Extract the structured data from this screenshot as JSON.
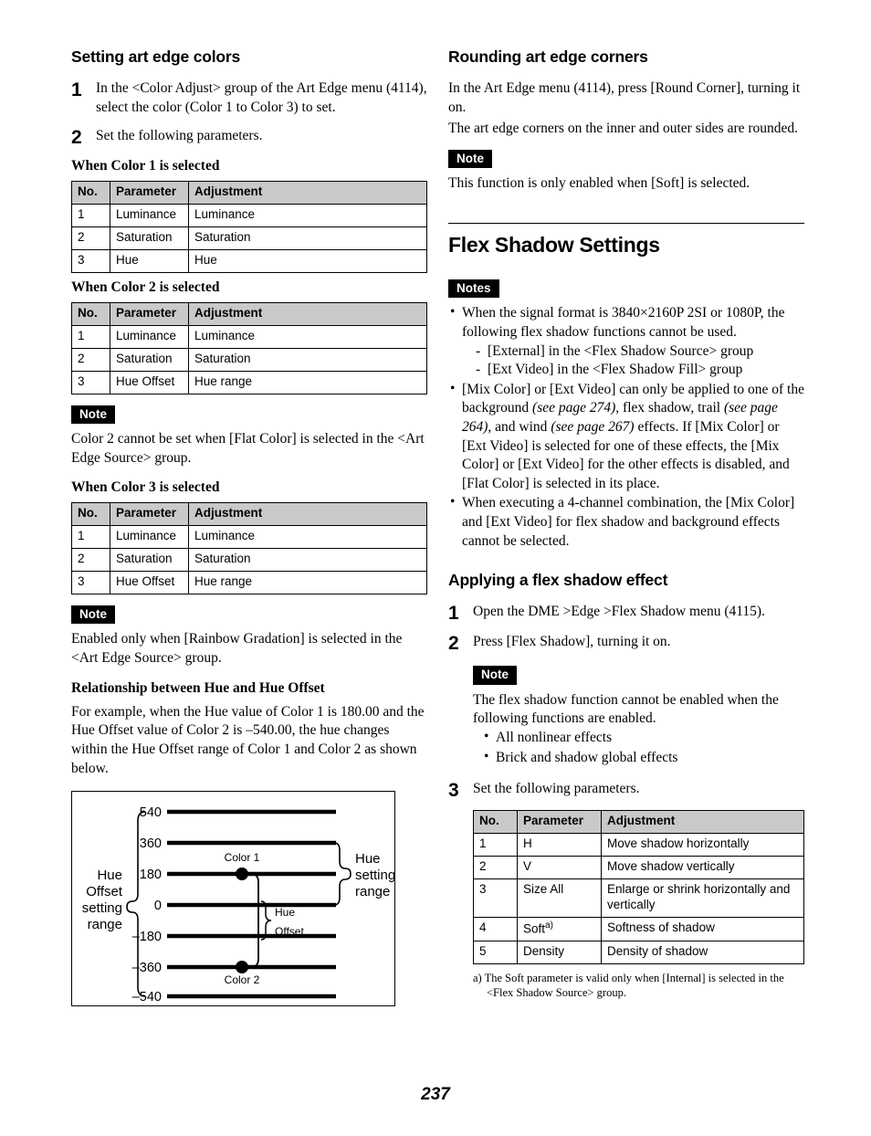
{
  "page": {
    "number": "237"
  },
  "left": {
    "heading": "Setting art edge colors",
    "step1_num": "1",
    "step1_text": "In the <Color Adjust> group of the Art Edge menu (4114), select the color (Color 1 to Color 3) to set.",
    "step2_num": "2",
    "step2_text": "Set the following parameters.",
    "color1_title": "When Color 1 is selected",
    "table1": {
      "headers": [
        "No.",
        "Parameter",
        "Adjustment"
      ],
      "rows": [
        [
          "1",
          "Luminance",
          "Luminance"
        ],
        [
          "2",
          "Saturation",
          "Saturation"
        ],
        [
          "3",
          "Hue",
          "Hue"
        ]
      ]
    },
    "color2_title": "When Color 2 is selected",
    "table2": {
      "headers": [
        "No.",
        "Parameter",
        "Adjustment"
      ],
      "rows": [
        [
          "1",
          "Luminance",
          "Luminance"
        ],
        [
          "2",
          "Saturation",
          "Saturation"
        ],
        [
          "3",
          "Hue Offset",
          "Hue range"
        ]
      ]
    },
    "note1_badge": "Note",
    "note1_text": "Color 2 cannot be set when [Flat Color] is selected in the <Art Edge Source> group.",
    "color3_title": "When Color 3 is selected",
    "table3": {
      "headers": [
        "No.",
        "Parameter",
        "Adjustment"
      ],
      "rows": [
        [
          "1",
          "Luminance",
          "Luminance"
        ],
        [
          "2",
          "Saturation",
          "Saturation"
        ],
        [
          "3",
          "Hue Offset",
          "Hue range"
        ]
      ]
    },
    "note2_badge": "Note",
    "note2_text": "Enabled only when [Rainbow Gradation] is selected in the <Art Edge Source> group.",
    "relationship_title": "Relationship between Hue and Hue Offset",
    "relationship_text": "For example, when the Hue value of Color 1 is 180.00 and the Hue Offset value of Color 2 is –540.00, the hue changes within the Hue Offset range of Color 1 and Color 2 as shown below."
  },
  "figure": {
    "axis_labels": [
      "540",
      "360",
      "180",
      "0",
      "–180",
      "–360",
      "–540"
    ],
    "left_bracket_label_lines": [
      "Hue",
      "Offset",
      "setting",
      "range"
    ],
    "right_bracket_label_lines": [
      "Hue",
      "setting",
      "range"
    ],
    "point1_label": "Color 1",
    "point2_label": "Color 2",
    "offset_label_lines": [
      "Hue",
      "Offset"
    ],
    "point1_value": 180,
    "point2_value": -360,
    "hue_range": [
      0,
      360
    ],
    "hue_offset_range": [
      -540,
      540
    ]
  },
  "right": {
    "heading": "Rounding art edge corners",
    "intro_line1": "In the Art Edge menu (4114), press [Round Corner], turning it on.",
    "intro_line2": "The art edge corners on the inner and outer sides are rounded.",
    "note1_badge": "Note",
    "note1_text": "This function is only enabled when [Soft] is selected.",
    "flex_heading": "Flex Shadow Settings",
    "notes_badge": "Notes",
    "note_b1_main": "When the signal format is 3840×2160P 2SI or 1080P, the following flex shadow functions cannot be used.",
    "note_b1_sub1": "[External] in the <Flex Shadow Source> group",
    "note_b1_sub2": "[Ext Video] in the <Flex Shadow Fill> group",
    "note_b2_p1": "[Mix Color] or [Ext Video] can only be applied to one of the background ",
    "note_b2_i1": "(see page 274)",
    "note_b2_p2": ", flex shadow, trail ",
    "note_b2_i2": "(see page 264)",
    "note_b2_p3": ", and wind ",
    "note_b2_i3": "(see page 267)",
    "note_b2_p4": " effects. If [Mix Color] or [Ext Video] is selected for one of these effects, the [Mix Color] or [Ext Video] for the other effects is disabled, and [Flat Color] is selected in its place.",
    "note_b3": "When executing a 4-channel combination, the [Mix Color] and [Ext Video] for flex shadow and background effects cannot be selected.",
    "apply_heading": "Applying a flex shadow effect",
    "step1_num": "1",
    "step1_text": "Open the DME >Edge >Flex Shadow menu (4115).",
    "step2_num": "2",
    "step2_text": "Press [Flex Shadow], turning it on.",
    "note2_badge": "Note",
    "note2_text": "The flex shadow function cannot be enabled when the following functions are enabled.",
    "note2_b1": "All nonlinear effects",
    "note2_b2": "Brick and shadow global effects",
    "step3_num": "3",
    "step3_text": "Set the following parameters.",
    "table": {
      "headers": [
        "No.",
        "Parameter",
        "Adjustment"
      ],
      "rows": [
        [
          "1",
          "H",
          "Move shadow horizontally"
        ],
        [
          "2",
          "V",
          "Move shadow vertically"
        ],
        [
          "3",
          "Size All",
          "Enlarge or shrink horizontally and vertically"
        ],
        [
          "4",
          "Soft",
          "Softness of shadow"
        ],
        [
          "5",
          "Density",
          "Density of shadow"
        ]
      ],
      "soft_footnote_marker": "a)"
    },
    "footnote_marker": "a)",
    "footnote_line1": "The Soft parameter is valid only when [Internal] is selected in the",
    "footnote_line2": "<Flex Shadow Source> group."
  }
}
